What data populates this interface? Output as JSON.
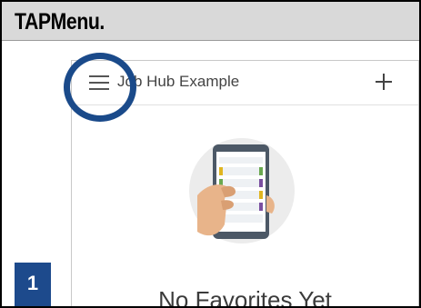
{
  "instruction": {
    "text": "TAPMenu."
  },
  "app": {
    "title": "Job Hub Example",
    "menu_icon": "hamburger-menu-icon",
    "add_icon": "plus-icon"
  },
  "empty_state": {
    "title": "No Favorites Yet",
    "illustration": "hand-holding-phone-illustration"
  },
  "step": {
    "number": "1"
  },
  "colors": {
    "instruction_bar": "#d9d9d9",
    "highlight_ring": "#1a4a8a",
    "step_badge": "#1d4a8c"
  }
}
